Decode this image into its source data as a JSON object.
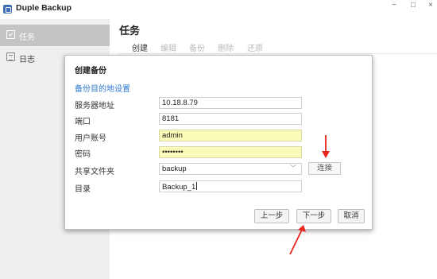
{
  "app": {
    "title": "Duple Backup",
    "window_controls": {
      "minimize": "−",
      "maximize": "□",
      "close": "×"
    }
  },
  "sidebar": {
    "items": [
      {
        "label": "任务",
        "icon": "task-check-icon",
        "active": true
      },
      {
        "label": "日志",
        "icon": "log-icon",
        "active": false
      }
    ]
  },
  "main": {
    "title": "任务",
    "toolbar": {
      "create": "创建",
      "edit": "编辑",
      "backup": "备份",
      "delete": "删除",
      "restore": "还原"
    }
  },
  "dialog": {
    "title": "创建备份",
    "section": "备份目的地设置",
    "fields": {
      "server": {
        "label": "服务器地址",
        "value": "10.18.8.79"
      },
      "port": {
        "label": "端口",
        "value": "8181"
      },
      "username": {
        "label": "用户账号",
        "value": "admin"
      },
      "password": {
        "label": "密码",
        "value": "••••••••"
      },
      "share": {
        "label": "共享文件夹",
        "value": "backup"
      },
      "directory": {
        "label": "目录",
        "value": "Backup_1"
      }
    },
    "connect_label": "连接",
    "buttons": {
      "prev": "上一步",
      "next": "下一步",
      "cancel": "取消"
    }
  },
  "colors": {
    "accent": "#2b78d0",
    "annotation_arrow": "#e8261c",
    "autofill": "#fafab9",
    "sidebar_active": "#c4c4c4"
  }
}
